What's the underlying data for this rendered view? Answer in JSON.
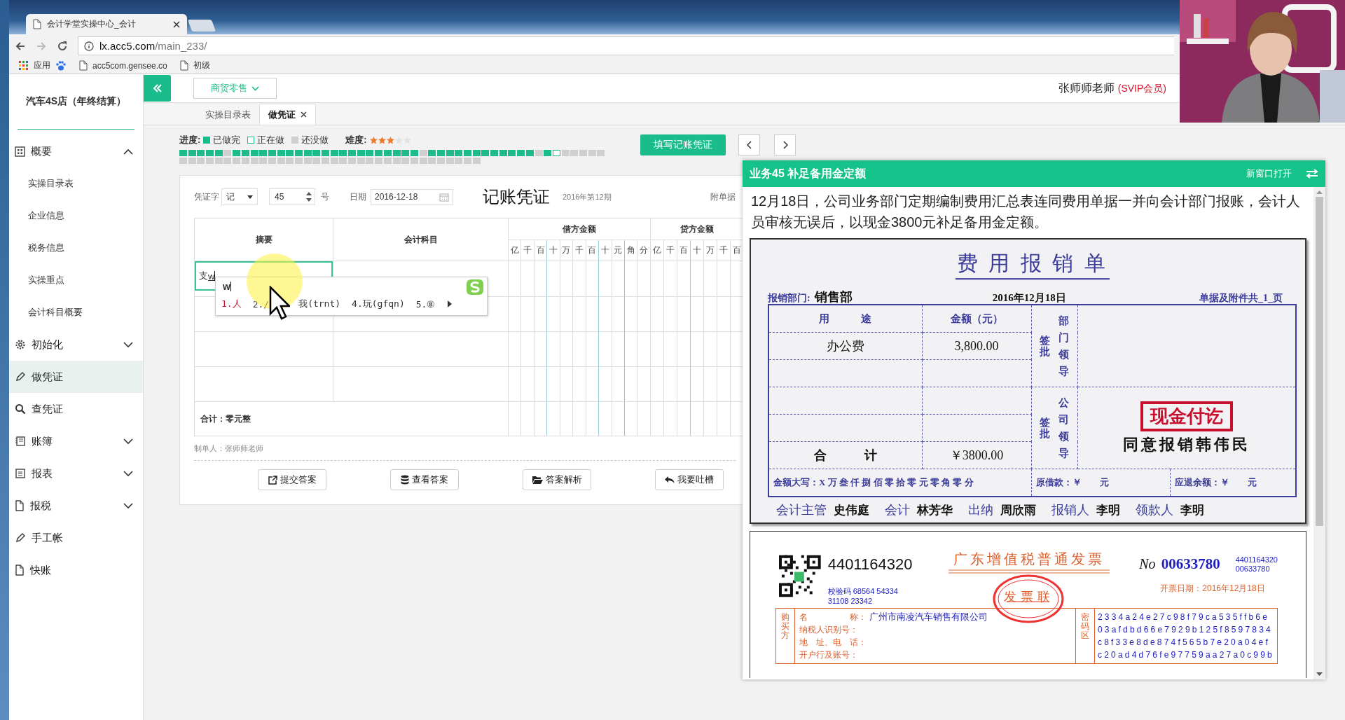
{
  "browser": {
    "tab_title": "会计学堂实操中心_会计",
    "url_host": "lx.acc5.com",
    "url_path": "/main_233/",
    "bookmarks": [
      {
        "label": "应用"
      },
      {
        "label": "acc5com.gensee.co"
      },
      {
        "label": "初级"
      }
    ]
  },
  "sidebar": {
    "company": "汽车4S店（年终结算）",
    "items": [
      {
        "label": "概要",
        "kind": "group",
        "expanded": true,
        "selected": false,
        "children": [
          {
            "label": "实操目录表"
          },
          {
            "label": "企业信息"
          },
          {
            "label": "税务信息"
          },
          {
            "label": "实操重点"
          },
          {
            "label": "会计科目概要"
          }
        ]
      },
      {
        "label": "初始化",
        "kind": "group",
        "expanded": false,
        "selected": false
      },
      {
        "label": "做凭证",
        "kind": "link",
        "selected": true
      },
      {
        "label": "查凭证",
        "kind": "link",
        "selected": false
      },
      {
        "label": "账簿",
        "kind": "group",
        "expanded": false,
        "selected": false
      },
      {
        "label": "报表",
        "kind": "group",
        "expanded": false,
        "selected": false
      },
      {
        "label": "报税",
        "kind": "group",
        "expanded": false,
        "selected": false
      },
      {
        "label": "手工帐",
        "kind": "link",
        "selected": false
      },
      {
        "label": "快账",
        "kind": "link",
        "selected": false
      }
    ]
  },
  "header": {
    "category": "商贸零售",
    "user": "张师师老师",
    "membership": "(SVIP会员)"
  },
  "tabs": [
    {
      "label": "实操目录表",
      "selected": false,
      "closable": false
    },
    {
      "label": "做凭证",
      "selected": true,
      "closable": true
    }
  ],
  "progress": {
    "label": "进度:",
    "legend": [
      {
        "label": "已做完",
        "kind": "done"
      },
      {
        "label": "正在做",
        "kind": "current"
      },
      {
        "label": "还没做",
        "kind": "todo"
      }
    ],
    "difficulty_label": "难度:",
    "stars": 3,
    "cells": [
      {
        "kind": "done"
      },
      {
        "kind": "done"
      },
      {
        "kind": "done"
      },
      {
        "kind": "done"
      },
      {
        "kind": "done"
      },
      {
        "kind": "todo"
      },
      {
        "kind": "done"
      },
      {
        "kind": "done"
      },
      {
        "kind": "done"
      },
      {
        "kind": "done"
      },
      {
        "kind": "done"
      },
      {
        "kind": "done"
      },
      {
        "kind": "done"
      },
      {
        "kind": "done"
      },
      {
        "kind": "done"
      },
      {
        "kind": "done"
      },
      {
        "kind": "done"
      },
      {
        "kind": "done"
      },
      {
        "kind": "done"
      },
      {
        "kind": "done"
      },
      {
        "kind": "done"
      },
      {
        "kind": "done"
      },
      {
        "kind": "done"
      },
      {
        "kind": "done"
      },
      {
        "kind": "done"
      },
      {
        "kind": "done"
      },
      {
        "kind": "done"
      },
      {
        "kind": "todo"
      },
      {
        "kind": "done"
      },
      {
        "kind": "done"
      },
      {
        "kind": "done"
      },
      {
        "kind": "done"
      },
      {
        "kind": "done"
      },
      {
        "kind": "done"
      },
      {
        "kind": "done"
      },
      {
        "kind": "done"
      },
      {
        "kind": "done"
      },
      {
        "kind": "done"
      },
      {
        "kind": "done"
      },
      {
        "kind": "done"
      },
      {
        "kind": "todo"
      },
      {
        "kind": "done"
      },
      {
        "kind": "current"
      },
      {
        "kind": "todo"
      },
      {
        "kind": "todo"
      },
      {
        "kind": "todo"
      },
      {
        "kind": "todo"
      },
      {
        "kind": "todo"
      },
      {
        "kind": "todo"
      },
      {
        "kind": "todo"
      },
      {
        "kind": "todo"
      },
      {
        "kind": "todo"
      },
      {
        "kind": "todo"
      },
      {
        "kind": "todo"
      },
      {
        "kind": "todo"
      },
      {
        "kind": "todo"
      },
      {
        "kind": "todo"
      },
      {
        "kind": "todo"
      },
      {
        "kind": "todo"
      },
      {
        "kind": "todo"
      },
      {
        "kind": "todo"
      },
      {
        "kind": "todo"
      },
      {
        "kind": "todo"
      },
      {
        "kind": "todo"
      },
      {
        "kind": "todo"
      },
      {
        "kind": "todo"
      },
      {
        "kind": "todo"
      },
      {
        "kind": "todo"
      },
      {
        "kind": "todo"
      },
      {
        "kind": "todo"
      },
      {
        "kind": "todo"
      },
      {
        "kind": "todo"
      },
      {
        "kind": "todo"
      },
      {
        "kind": "todo"
      },
      {
        "kind": "todo"
      },
      {
        "kind": "todo"
      },
      {
        "kind": "todo"
      },
      {
        "kind": "todo"
      },
      {
        "kind": "todo"
      },
      {
        "kind": "todo"
      },
      {
        "kind": "todo"
      },
      {
        "kind": "todo"
      }
    ]
  },
  "fill_button": "填写记账凭证",
  "voucher": {
    "word_label": "凭证字",
    "word": "记",
    "number": "45",
    "number_suffix": "号",
    "date_label": "日期",
    "date": "2016-12-18",
    "title": "记账凭证",
    "period": "2016年第12期",
    "attachments_label": "附单据",
    "columns": {
      "summary": "摘要",
      "account": "会计科目",
      "debit": "借方金额",
      "credit": "贷方金额"
    },
    "debit_digits": [
      "亿",
      "千",
      "百",
      "十",
      "万",
      "千",
      "百",
      "十",
      "元",
      "角",
      "分"
    ],
    "credit_digits": [
      "亿",
      "千",
      "百",
      "十",
      "万",
      "千",
      "百"
    ],
    "rows": [
      {
        "summary": "支",
        "composing": "w",
        "editing": true
      },
      {
        "editing": false
      },
      {
        "editing": false
      },
      {
        "editing": false
      }
    ],
    "total": "合计：零元整",
    "maker": "制单人：张师师老师",
    "buttons": [
      {
        "label": "提交答案"
      },
      {
        "label": "查看答案"
      },
      {
        "label": "答案解析"
      },
      {
        "label": "我要吐槽"
      }
    ]
  },
  "ime": {
    "composition": "w",
    "candidates": [
      {
        "text": "1.人",
        "selected": true
      },
      {
        "text": "2./",
        "selected": false
      },
      {
        "text": "我(trnt)",
        "selected": false
      },
      {
        "text": "4.玩(gfqn)",
        "selected": false
      },
      {
        "text": "5.⑧",
        "selected": false
      }
    ]
  },
  "task_panel": {
    "title": "业务45 补足备用金定额",
    "open_new": "新窗口打开",
    "description": "12月18日，公司业务部门定期编制费用汇总表连同费用单据一并向会计部门报账，会计人员审核无误后，以现金3800元补足备用金定额。"
  },
  "expense_form": {
    "title": "费 用 报 销 单",
    "dept_label": "报销部门:",
    "dept": "销售部",
    "date": "2016年12月18日",
    "pages": "单据及附件共_1_页",
    "use_header": "用　　　途",
    "amount_header": "金额（元）",
    "items": [
      {
        "use": "办公费",
        "amount": "3,800.00"
      }
    ],
    "approvals": [
      {
        "sign": "签批",
        "approver": "部门领导"
      },
      {
        "sign": "签批",
        "approver": "公司领导"
      }
    ],
    "total_label": "合　　　计",
    "total": "￥3800.00",
    "paid_stamp": "现金付讫",
    "approval_note": "同意报销韩伟民",
    "amount_words": "金额大写：X 万 叁 仟 捌 佰 零 拾 零 元 零 角 零 分",
    "borrowed": "原借款：￥　　元",
    "refund": "应退余额：￥　　元",
    "signatures": [
      {
        "role": "会计主管",
        "name": "史伟庭"
      },
      {
        "role": "会计",
        "name": "林芳华"
      },
      {
        "role": "出纳",
        "name": "周欣雨"
      },
      {
        "role": "报销人",
        "name": "李明"
      },
      {
        "role": "领款人",
        "name": "李明"
      }
    ]
  },
  "invoice": {
    "code": "4401164320",
    "title": "广东增值税普通发票",
    "copy": "发票联",
    "no_label": "No",
    "number": "00633780",
    "code_small": "4401164320",
    "number_small": "00633780",
    "date": "开票日期：2016年12月18日",
    "check_code": "校验码 68564 54334 31108 23342",
    "buyer_label": "购买方",
    "buyer_fields": [
      {
        "label": "名　　　　　称：",
        "value": "广州市南凌汽车销售有限公司"
      },
      {
        "label": "纳税人识别号："
      },
      {
        "label": "地　址、电　话："
      },
      {
        "label": "开户行及账号："
      }
    ],
    "cipher_label": "密码区",
    "cipher": [
      "2334a24e27c98f79ca535ffb6e",
      "03afdbd66e7929b125f8597834",
      "c8f33e8de874f565b7e20a04ef",
      "c20ad4d76fe97759aa27a0c99b"
    ]
  }
}
